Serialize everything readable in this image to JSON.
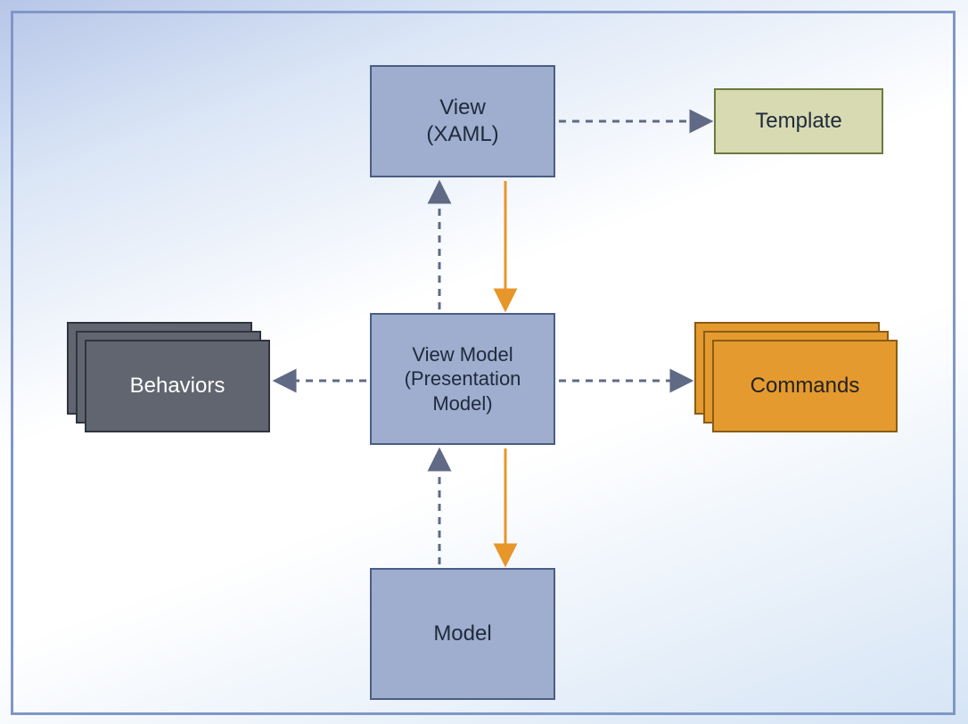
{
  "diagram": {
    "nodes": {
      "view": {
        "label": "View\n(XAML)"
      },
      "template": {
        "label": "Template"
      },
      "viewmodel": {
        "label": "View Model\n(Presentation\nModel)"
      },
      "behaviors": {
        "label": "Behaviors"
      },
      "commands": {
        "label": "Commands"
      },
      "model": {
        "label": "Model"
      }
    },
    "connectors": [
      {
        "from": "view",
        "to": "template",
        "style": "dashed",
        "color": "#606a85"
      },
      {
        "from": "viewmodel",
        "to": "view",
        "style": "dashed",
        "color": "#606a85"
      },
      {
        "from": "view",
        "to": "viewmodel",
        "style": "solid",
        "color": "#e7962a"
      },
      {
        "from": "viewmodel",
        "to": "behaviors",
        "style": "dashed",
        "color": "#606a85"
      },
      {
        "from": "viewmodel",
        "to": "commands",
        "style": "dashed",
        "color": "#606a85"
      },
      {
        "from": "model",
        "to": "viewmodel",
        "style": "dashed",
        "color": "#606a85"
      },
      {
        "from": "viewmodel",
        "to": "model",
        "style": "solid",
        "color": "#e7962a"
      }
    ],
    "colors": {
      "box_blue": "#9fadce",
      "box_olive": "#d8dab1",
      "stack_gray": "#60656f",
      "stack_orange": "#e49a2f",
      "arrow_solid": "#e7962a",
      "arrow_dashed": "#606a85",
      "frame_border": "#7f97c6"
    }
  }
}
